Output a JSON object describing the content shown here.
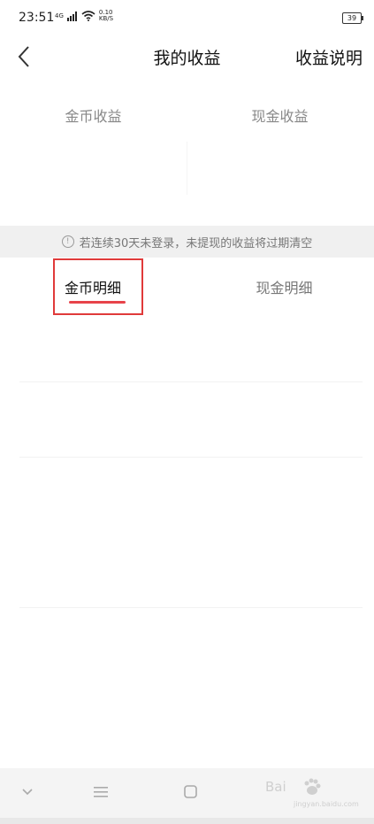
{
  "status_bar": {
    "time": "23:51",
    "network": "4G",
    "speed_value": "0.10",
    "speed_unit": "KB/S",
    "battery": "39"
  },
  "nav": {
    "title": "我的收益",
    "explain": "收益说明"
  },
  "summary": {
    "coin_label": "金币收益",
    "cash_label": "现金收益"
  },
  "notice": {
    "icon": "!",
    "text": "若连续30天未登录，未提现的收益将过期清空"
  },
  "tabs": [
    {
      "label": "金币明细",
      "active": true
    },
    {
      "label": "现金明细",
      "active": false
    }
  ],
  "accent_color": "#e7434a",
  "watermark": {
    "text": "Bai",
    "sub": "jingyan.baidu.com"
  }
}
